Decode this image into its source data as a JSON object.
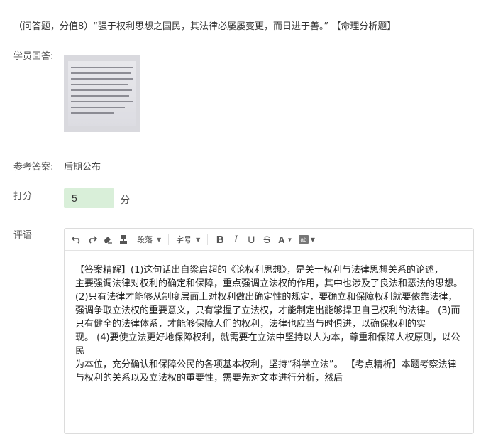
{
  "question": {
    "text": "（问答题，分值8）“强于权利思想之国民，其法律必屡屡变更，而日进于善。” 【命理分析题】"
  },
  "student_answer": {
    "label": "学员回答:",
    "image_alt": "handwritten answer photo"
  },
  "reference_answer": {
    "label": "参考答案:",
    "value": "后期公布"
  },
  "score": {
    "label": "打分",
    "value": "5",
    "unit": "分"
  },
  "comment": {
    "label": "评语",
    "toolbar": {
      "paragraph_label": "段落",
      "font_size_label": "字号"
    },
    "paragraphs": [
      "【答案精解】(1)这句话出自梁启超的《论权利思想》，是关于权利与法律思想关系的论述，",
      "主要强调法律对权利的确定和保障，重点强调立法权的作用，其中也涉及了良法和恶法的思想。 (2)只有法律才能够从制度层面上对权利做出确定性的规定，要确立和保障权利就要依靠法律，",
      "强调争取立法权的重要意义，只有掌握了立法权，才能制定出能够捍卫自己权利的法律。 (3)而只有健全的法律体系，才能够保障人们的权利，法律也应当与时俱进，以确保权利的实",
      "现。 (4)要使立法更好地保障权利，就需要在立法中坚持以人为本，尊重和保障人权原则，以公民",
      "为本位，充分确认和保障公民的各项基本权利，坚持“科学立法”。 【考点精析】本题考察法律与权利的关系以及立法权的重要性，需要先对文本进行分析，然后"
    ]
  },
  "colors": {
    "score_bg": "#d9efd9",
    "border": "#dcdcdc"
  }
}
